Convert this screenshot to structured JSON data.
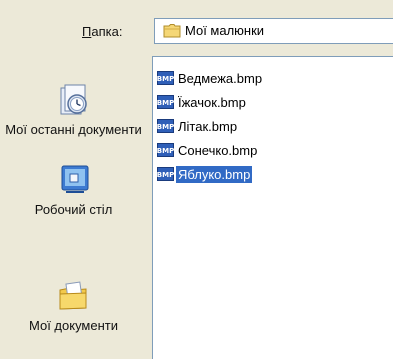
{
  "lookin": {
    "label_ul": "П",
    "label_rest": "апка:",
    "value": "Мої малюнки"
  },
  "places": [
    {
      "label": "Мої останні документи"
    },
    {
      "label": "Робочий стіл"
    },
    {
      "label": "Мої документи"
    }
  ],
  "files": [
    {
      "name": "Ведмежа.bmp",
      "selected": false
    },
    {
      "name": "Їжачок.bmp",
      "selected": false
    },
    {
      "name": "Літак.bmp",
      "selected": false
    },
    {
      "name": "Сонечко.bmp",
      "selected": false
    },
    {
      "name": "Яблуко.bmp",
      "selected": true
    }
  ],
  "icons": {
    "lookin_folder": "folder-icon",
    "recent": "recent-documents-icon",
    "desktop": "desktop-icon",
    "mydocs": "my-documents-icon",
    "file": "bmp-file-icon"
  },
  "colors": {
    "dialog_bg": "#ece9d8",
    "selection": "#316ac5",
    "border": "#7f9db9"
  }
}
